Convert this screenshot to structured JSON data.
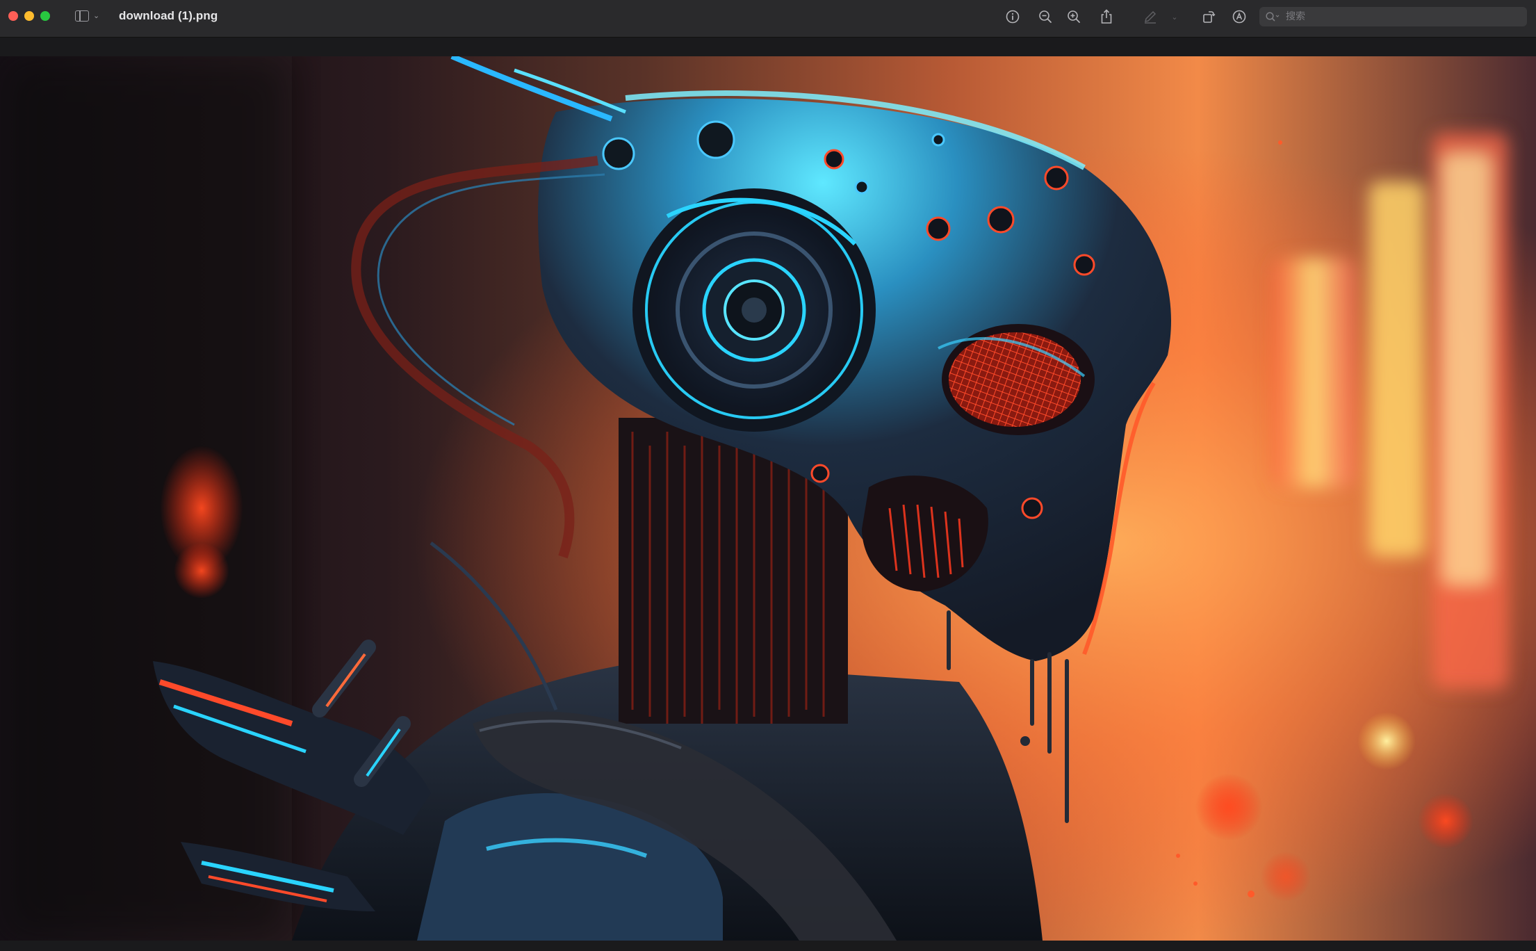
{
  "window": {
    "title": "download (1).png"
  },
  "toolbar": {
    "icons": [
      "sidebar-toggle-icon",
      "info-icon",
      "zoom-out-icon",
      "zoom-in-icon",
      "share-icon",
      "markup-icon",
      "rotate-icon",
      "annotate-icon"
    ],
    "search": {
      "placeholder": "搜索",
      "value": ""
    }
  },
  "image": {
    "subject": "cyberpunk robot artwork",
    "colors": {
      "accent_cyan": "#2ad4ff",
      "accent_red": "#ff3a1f",
      "background_warm": "#ff8a3a",
      "background_dark": "#140f14"
    }
  }
}
